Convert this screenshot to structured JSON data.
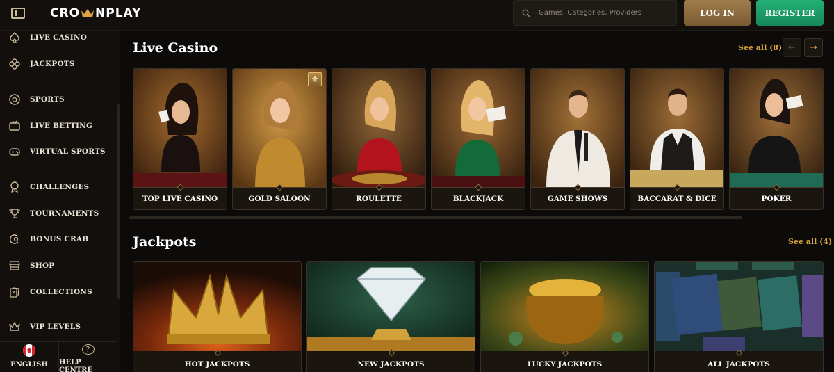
{
  "header": {
    "logo_text_before": "CRO",
    "logo_text_after": "NPLAY",
    "search_placeholder": "Games, Categories, Providers",
    "login_label": "LOG IN",
    "register_label": "REGISTER"
  },
  "sidebar": {
    "items": [
      {
        "label": "LIVE CASINO",
        "icon": "spade-icon"
      },
      {
        "label": "JACKPOTS",
        "icon": "clover-icon"
      },
      {
        "label": "SPORTS",
        "icon": "soccer-ball-icon"
      },
      {
        "label": "LIVE BETTING",
        "icon": "tv-icon"
      },
      {
        "label": "VIRTUAL SPORTS",
        "icon": "gamepad-icon"
      },
      {
        "label": "CHALLENGES",
        "icon": "medal-icon"
      },
      {
        "label": "TOURNAMENTS",
        "icon": "trophy-icon"
      },
      {
        "label": "BONUS CRAB",
        "icon": "bonus-crab-icon"
      },
      {
        "label": "SHOP",
        "icon": "shop-icon"
      },
      {
        "label": "COLLECTIONS",
        "icon": "cards-icon"
      },
      {
        "label": "VIP LEVELS",
        "icon": "crown-icon"
      }
    ],
    "footer": {
      "language_label": "ENGLISH",
      "help_label": "HELP CENTRE",
      "help_glyph": "?"
    }
  },
  "live_casino": {
    "title": "Live Casino",
    "see_all": "See all (8)",
    "prev_glyph": "←",
    "next_glyph": "→",
    "cards": [
      {
        "label": "TOP LIVE CASINO"
      },
      {
        "label": "GOLD SALOON",
        "badge": "⚜"
      },
      {
        "label": "ROULETTE"
      },
      {
        "label": "BLACKJACK"
      },
      {
        "label": "GAME SHOWS"
      },
      {
        "label": "BACCARAT & DICE"
      },
      {
        "label": "POKER"
      }
    ]
  },
  "jackpots": {
    "title": "Jackpots",
    "see_all": "See all (4)",
    "cards": [
      {
        "label": "HOT JACKPOTS"
      },
      {
        "label": "NEW JACKPOTS"
      },
      {
        "label": "LUCKY JACKPOTS"
      },
      {
        "label": "ALL JACKPOTS"
      }
    ]
  },
  "colors": {
    "accent_gold": "#d9a441",
    "login_bg": "#8d6b3f",
    "register_bg": "#1e9d69",
    "background": "#0d0b09"
  }
}
